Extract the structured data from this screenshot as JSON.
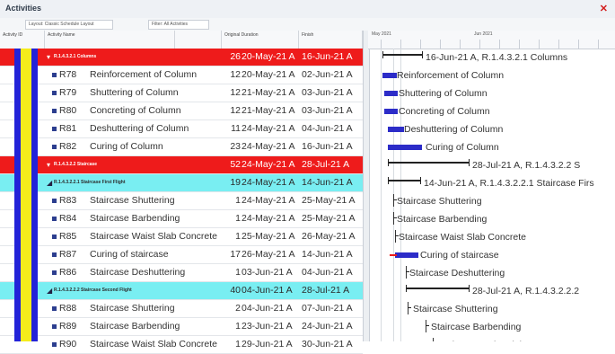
{
  "window": {
    "title": "Activities",
    "close_icon": "close-icon"
  },
  "toolbar": {
    "buttons": [
      "Layout: Classic Schedule Layout",
      "Filter: All Activities"
    ]
  },
  "columns": {
    "wbs": "Activity ID",
    "name": "Activity Name",
    "dur_start": "Original Duration",
    "finish": "Finish"
  },
  "colors": {
    "wbs_red": "#ee1b1b",
    "wbs_cyan": "#79eef2",
    "band_blue": "#2323d8",
    "band_yellow": "#f5ec1b",
    "bar_blue": "#2c2cc8"
  },
  "rows": [
    {
      "kind": "wbs-red",
      "code": "R.1.4.3.2.1 Columns",
      "dur": "26",
      "start": "20-May-21 A",
      "finish": "16-Jun-21 A"
    },
    {
      "kind": "act",
      "id": "R78",
      "name": "Reinforcement of Column",
      "dur": "12",
      "start": "20-May-21 A",
      "finish": "02-Jun-21 A"
    },
    {
      "kind": "act",
      "id": "R79",
      "name": "Shuttering of Column",
      "dur": "12",
      "start": "21-May-21 A",
      "finish": "03-Jun-21 A"
    },
    {
      "kind": "act",
      "id": "R80",
      "name": "Concreting of Column",
      "dur": "12",
      "start": "21-May-21 A",
      "finish": "03-Jun-21 A"
    },
    {
      "kind": "act",
      "id": "R81",
      "name": "Deshuttering of Column",
      "dur": "11",
      "start": "24-May-21 A",
      "finish": "04-Jun-21 A"
    },
    {
      "kind": "act",
      "id": "R82",
      "name": "Curing of Column",
      "dur": "23",
      "start": "24-May-21 A",
      "finish": "16-Jun-21 A"
    },
    {
      "kind": "wbs-red",
      "code": "R.1.4.3.2.2 Staircase",
      "dur": "52",
      "start": "24-May-21 A",
      "finish": "28-Jul-21 A"
    },
    {
      "kind": "wbs-cyan",
      "code": "R.1.4.3.2.2.1 Staircase First Flight",
      "dur": "19",
      "start": "24-May-21 A",
      "finish": "14-Jun-21 A"
    },
    {
      "kind": "act",
      "id": "R83",
      "name": "Staircase Shuttering",
      "dur": "1",
      "start": "24-May-21 A",
      "finish": "25-May-21 A"
    },
    {
      "kind": "act",
      "id": "R84",
      "name": "Staircase Barbending",
      "dur": "1",
      "start": "24-May-21 A",
      "finish": "25-May-21 A"
    },
    {
      "kind": "act",
      "id": "R85",
      "name": "Staircase Waist Slab Concrete",
      "dur": "1",
      "start": "25-May-21 A",
      "finish": "26-May-21 A"
    },
    {
      "kind": "act",
      "id": "R87",
      "name": "Curing of staircase",
      "dur": "17",
      "start": "26-May-21 A",
      "finish": "14-Jun-21 A"
    },
    {
      "kind": "act",
      "id": "R86",
      "name": "Staircase Deshuttering",
      "dur": "1",
      "start": "03-Jun-21 A",
      "finish": "04-Jun-21 A"
    },
    {
      "kind": "wbs-cyan",
      "code": "R.1.4.3.2.2.2 Staircase Second Flight",
      "dur": "40",
      "start": "04-Jun-21 A",
      "finish": "28-Jul-21 A"
    },
    {
      "kind": "act",
      "id": "R88",
      "name": "Staircase Shuttering",
      "dur": "2",
      "start": "04-Jun-21 A",
      "finish": "07-Jun-21 A"
    },
    {
      "kind": "act",
      "id": "R89",
      "name": "Staircase Barbending",
      "dur": "1",
      "start": "23-Jun-21 A",
      "finish": "24-Jun-21 A"
    },
    {
      "kind": "act",
      "id": "R90",
      "name": "Staircase Waist Slab Concrete",
      "dur": "1",
      "start": "29-Jun-21 A",
      "finish": "30-Jun-21 A"
    }
  ],
  "gantt": {
    "header_top": [
      "May 2021",
      "Jun 2021"
    ],
    "labels": [
      "16-Jun-21 A, R.1.4.3.2.1  Columns",
      "Reinforcement of Column",
      "Shuttering of Column",
      "Concreting of Column",
      "Deshuttering of Column",
      "Curing of Column",
      "28-Jul-21 A, R.1.4.3.2.2  S",
      "14-Jun-21 A, R.1.4.3.2.2.1  Staircase Firs",
      "Staircase Shuttering",
      "Staircase Barbending",
      "Staircase Waist Slab Concrete",
      "Curing of staircase",
      "Staircase Deshuttering",
      "28-Jul-21 A, R.1.4.3.2.2.2",
      "Staircase Shuttering",
      "Staircase Barbending",
      "Staircase Waist Slab Concrete"
    ]
  }
}
